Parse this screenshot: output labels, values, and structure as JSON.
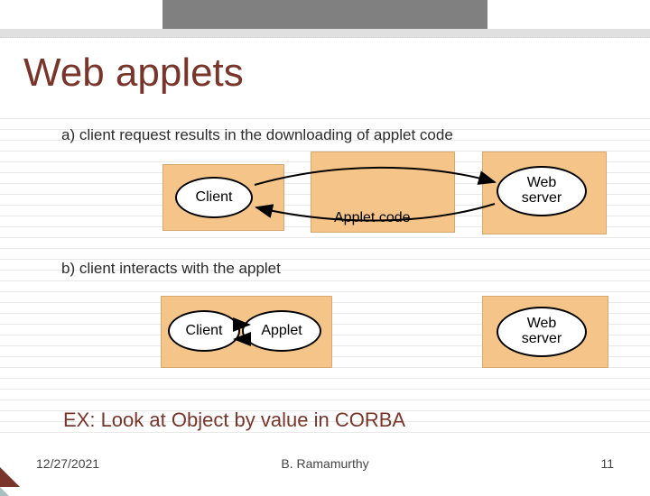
{
  "title": "Web applets",
  "caption_a": "a) client request results in the downloading of applet code",
  "caption_b": "b) client  interacts with the applet",
  "labels": {
    "client": "Client",
    "applet_code": "Applet code",
    "web": "Web",
    "server": "server",
    "applet": "Applet"
  },
  "ex_line": "EX: Look at Object by value in CORBA",
  "footer": {
    "date": "12/27/2021",
    "author": "B. Ramamurthy",
    "page": "11"
  }
}
